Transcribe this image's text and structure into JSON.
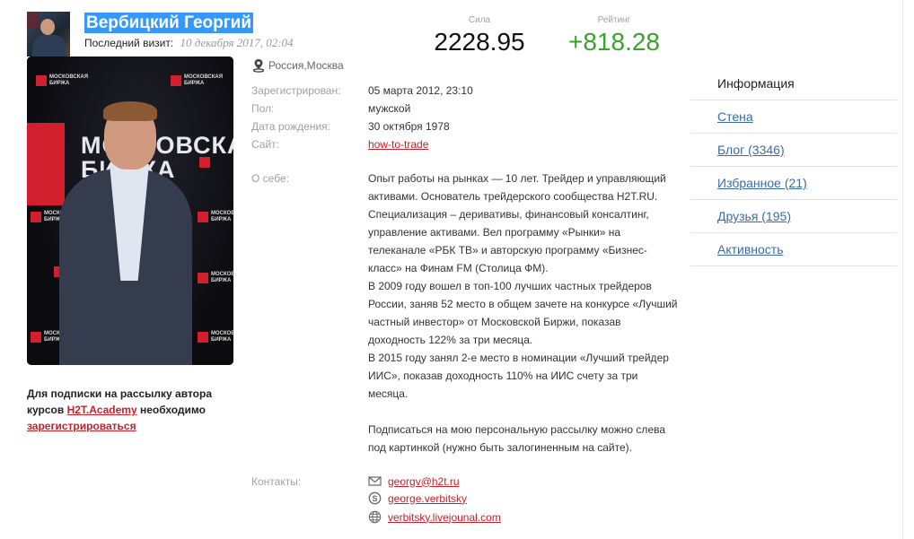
{
  "profile": {
    "name": "Вербицкий Георгий",
    "last_visit_label": "Последний визит:",
    "last_visit_date": "10 декабря 2017, 02:04"
  },
  "stats": {
    "strength_label": "Сила",
    "strength_value": "2228.95",
    "rating_label": "Рейтинг",
    "rating_value": "+818.28"
  },
  "photo": {
    "logo_text": "МОСКОВСКАЯ БИРЖА",
    "big_line1": "МОСКОВСКАЯ",
    "big_line2": "БИРЖА"
  },
  "info": {
    "location": "Россия,Москва",
    "registered_label": "Зарегистрирован:",
    "registered_value": "05 марта 2012, 23:10",
    "gender_label": "Пол:",
    "gender_value": "мужской",
    "birthdate_label": "Дата рождения:",
    "birthdate_value": "30 октября 1978",
    "site_label": "Сайт:",
    "site_value": "how-to-trade",
    "about_label": "О себе:",
    "about_p1": "Опыт работы на рынках — 10 лет. Трейдер и управляющий активами. Основатель трейдерского сообщества H2T.RU. Специализация – деривативы, финансовый консалтинг, управление активами. Вел программу «Рынки» на телеканале «РБК ТВ» и авторскую программу «Бизнес-класс» на Финам FM (Столица ФМ).",
    "about_p2": "В 2009 году вошел в топ-100 лучших частных трейдеров России, заняв 52 место в общем зачете на конкурсе «Лучший частный инвестор» от Московской Биржи, показав доходность 122% за три месяца.",
    "about_p3": "В 2015 году занял 2-е место в номинации «Лучший трейдер ИИС», показав доходность 110% на ИИС счету за три месяца.",
    "about_p4": "Подписаться на мою персональную рассылку можно слева под картинкой (нужно быть залогиненным на сайте).",
    "contacts_label": "Контакты:",
    "email": "georgv@h2t.ru",
    "skype": "george.verbitsky",
    "web": "verbitsky.livejounal.com"
  },
  "subscribe": {
    "text1": "Для подписки на рассылку автора курсов ",
    "academy_link": "H2T.Academy",
    "text2": " необходимо",
    "register_link": "зарегистрироваться"
  },
  "sidebar": {
    "items": [
      {
        "label": "Информация"
      },
      {
        "label": "Стена"
      },
      {
        "label": "Блог (3346)"
      },
      {
        "label": "Избранное (21)"
      },
      {
        "label": "Друзья (195)"
      },
      {
        "label": "Активность"
      }
    ]
  },
  "colors": {
    "accent_red": "#c8202a",
    "rating_green": "#3aa22f",
    "link_blue": "#3a6ba8",
    "selection_blue": "#3399ff"
  }
}
